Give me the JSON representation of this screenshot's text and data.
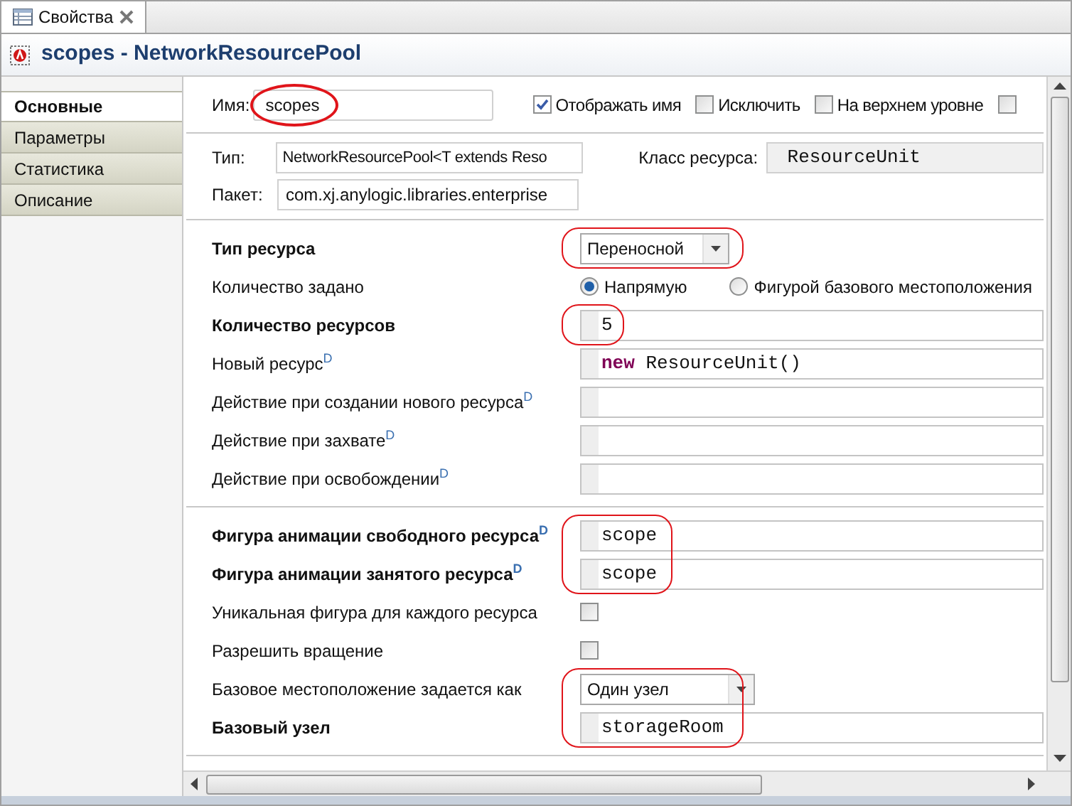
{
  "tab": {
    "title": "Свойства"
  },
  "header": {
    "title": "scopes - NetworkResourcePool"
  },
  "sidebar": [
    {
      "label": "Основные",
      "selected": true
    },
    {
      "label": "Параметры",
      "selected": false
    },
    {
      "label": "Статистика",
      "selected": false
    },
    {
      "label": "Описание",
      "selected": false
    }
  ],
  "name_row": {
    "label": "Имя:",
    "value": "scopes",
    "circled": true,
    "checkboxes": [
      {
        "label": "Отображать имя",
        "checked": true
      },
      {
        "label": "Исключить",
        "checked": false
      },
      {
        "label": "На верхнем уровне",
        "checked": false
      },
      {
        "checked": false
      }
    ]
  },
  "type_rows": {
    "type_label": "Тип:",
    "type_value": "NetworkResourcePool<T extends Reso",
    "class_label": "Класс ресурса:",
    "class_value": "ResourceUnit",
    "package_label": "Пакет:",
    "package_value": "com.xj.anylogic.libraries.enterprise"
  },
  "sections": [
    {
      "groups": [
        {
          "circled": true,
          "rows": [
            {
              "kind": "dropdown",
              "label": "Тип ресурса",
              "bold": true,
              "value": "Переносной",
              "wide": false
            }
          ]
        },
        {
          "circled": false,
          "rows": [
            {
              "kind": "radio",
              "label": "Количество задано",
              "bold": false,
              "options": [
                {
                  "label": "Напрямую",
                  "selected": true
                },
                {
                  "label": "Фигурой базового местоположения",
                  "selected": false
                }
              ]
            }
          ]
        },
        {
          "circled": true,
          "rows": [
            {
              "kind": "code",
              "label": "Количество ресурсов",
              "bold": true,
              "value": "5"
            }
          ]
        },
        {
          "circled": false,
          "rows": [
            {
              "kind": "code",
              "label": "Новый ресурс$^{D}$",
              "bold": false,
              "value": "**new** ResourceUnit()"
            },
            {
              "kind": "code",
              "label": "Действие при создании нового ресурса$^{D}$",
              "bold": false
            },
            {
              "kind": "code",
              "label": "Действие при захвате$^{D}$",
              "bold": false
            },
            {
              "kind": "code",
              "label": "Действие при освобождении$^{D}$",
              "bold": false
            }
          ]
        }
      ]
    },
    {
      "groups": [
        {
          "circled": true,
          "rows": [
            {
              "kind": "code",
              "label": "Фигура анимации свободного ресурса$^{D}$",
              "bold": true,
              "value": "scope"
            },
            {
              "kind": "code",
              "label": "Фигура анимации занятого ресурса$^{D}$",
              "bold": true,
              "value": "scope"
            }
          ]
        },
        {
          "circled": false,
          "rows": [
            {
              "kind": "checkbox",
              "label": "Уникальная фигура для каждого ресурса",
              "bold": false,
              "checked": false
            },
            {
              "kind": "checkbox",
              "label": "Разрешить вращение",
              "bold": false,
              "checked": false
            }
          ]
        },
        {
          "circled": true,
          "rows": [
            {
              "kind": "dropdown",
              "label": "Базовое местоположение задается как",
              "bold": false,
              "value": "Один узел",
              "wide": true
            },
            {
              "kind": "code",
              "label": "Базовый узел",
              "bold": true,
              "value": "storageRoom"
            }
          ]
        }
      ]
    }
  ]
}
